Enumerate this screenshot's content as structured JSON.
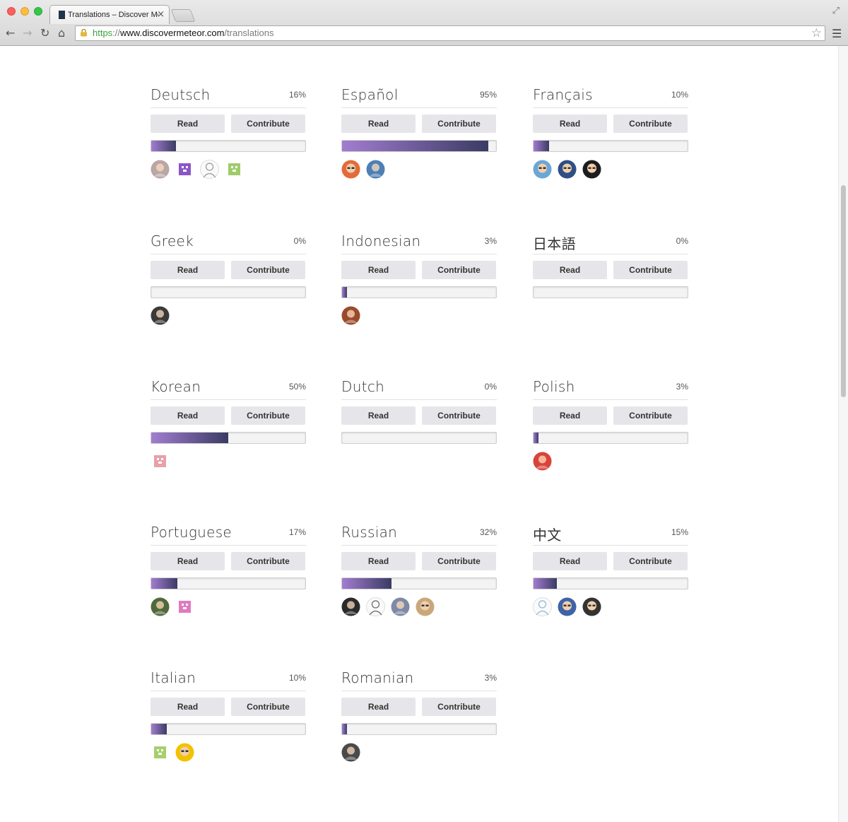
{
  "browser": {
    "tab_title": "Translations – Discover Meteor",
    "tab_close": "×",
    "url_scheme": "https",
    "url_sep": "://",
    "url_host": "www.discovermeteor.com",
    "url_path": "/translations",
    "icons": [
      "back-icon",
      "forward-icon",
      "reload-icon",
      "home-icon",
      "lock-icon",
      "star-icon",
      "menu-icon"
    ]
  },
  "buttons": {
    "read": "Read",
    "contribute": "Contribute"
  },
  "colors": {
    "progress_start": "#a27dd0",
    "progress_end": "#3a3b64",
    "button_bg": "#e6e6ea"
  },
  "languages": [
    {
      "name": "Deutsch",
      "percent_label": "16%",
      "progress": 0.16,
      "avatars": [
        {
          "k": "photo",
          "c": "#b9a6a6"
        },
        {
          "k": "pixel",
          "c": "#8a55c8"
        },
        {
          "k": "sketch",
          "c": "#999"
        },
        {
          "k": "pixel",
          "c": "#9fcc6a"
        }
      ]
    },
    {
      "name": "Español",
      "percent_label": "95%",
      "progress": 0.95,
      "avatars": [
        {
          "k": "cartoon",
          "c": "#e36b3a"
        },
        {
          "k": "photo",
          "c": "#4e7fb5"
        }
      ]
    },
    {
      "name": "Français",
      "percent_label": "10%",
      "progress": 0.1,
      "avatars": [
        {
          "k": "cartoon",
          "c": "#6aa6d8"
        },
        {
          "k": "cartoon",
          "c": "#2d4f86"
        },
        {
          "k": "cartoon",
          "c": "#1c1c1c"
        }
      ]
    },
    {
      "name": "Greek",
      "percent_label": "0%",
      "progress": 0.0,
      "avatars": [
        {
          "k": "photo",
          "c": "#3a3a3a"
        }
      ]
    },
    {
      "name": "Indonesian",
      "percent_label": "3%",
      "progress": 0.03,
      "avatars": [
        {
          "k": "photo",
          "c": "#9a4a2c"
        }
      ]
    },
    {
      "name": "日本語",
      "percent_label": "0%",
      "progress": 0.0,
      "avatars": []
    },
    {
      "name": "Korean",
      "percent_label": "50%",
      "progress": 0.5,
      "avatars": [
        {
          "k": "pixel",
          "c": "#e6a1a9"
        }
      ]
    },
    {
      "name": "Dutch",
      "percent_label": "0%",
      "progress": 0.0,
      "avatars": []
    },
    {
      "name": "Polish",
      "percent_label": "3%",
      "progress": 0.03,
      "avatars": [
        {
          "k": "photo",
          "c": "#d8443a"
        }
      ]
    },
    {
      "name": "Portuguese",
      "percent_label": "17%",
      "progress": 0.17,
      "avatars": [
        {
          "k": "photo",
          "c": "#4f6a3a"
        },
        {
          "k": "pixel",
          "c": "#e07ac0"
        }
      ]
    },
    {
      "name": "Russian",
      "percent_label": "32%",
      "progress": 0.32,
      "avatars": [
        {
          "k": "photo",
          "c": "#2a2a2a"
        },
        {
          "k": "sketch",
          "c": "#666"
        },
        {
          "k": "photo",
          "c": "#7d8aa6"
        },
        {
          "k": "cartoon",
          "c": "#caa77b"
        }
      ]
    },
    {
      "name": "中文",
      "percent_label": "15%",
      "progress": 0.15,
      "avatars": [
        {
          "k": "sketch",
          "c": "#8ab6d8"
        },
        {
          "k": "cartoon",
          "c": "#3d63a8"
        },
        {
          "k": "cartoon",
          "c": "#333"
        }
      ]
    },
    {
      "name": "Italian",
      "percent_label": "10%",
      "progress": 0.1,
      "avatars": [
        {
          "k": "pixel",
          "c": "#a6cf6d"
        },
        {
          "k": "cartoon",
          "c": "#f2c200"
        }
      ]
    },
    {
      "name": "Romanian",
      "percent_label": "3%",
      "progress": 0.03,
      "avatars": [
        {
          "k": "photo",
          "c": "#4a4a4a"
        }
      ]
    }
  ]
}
